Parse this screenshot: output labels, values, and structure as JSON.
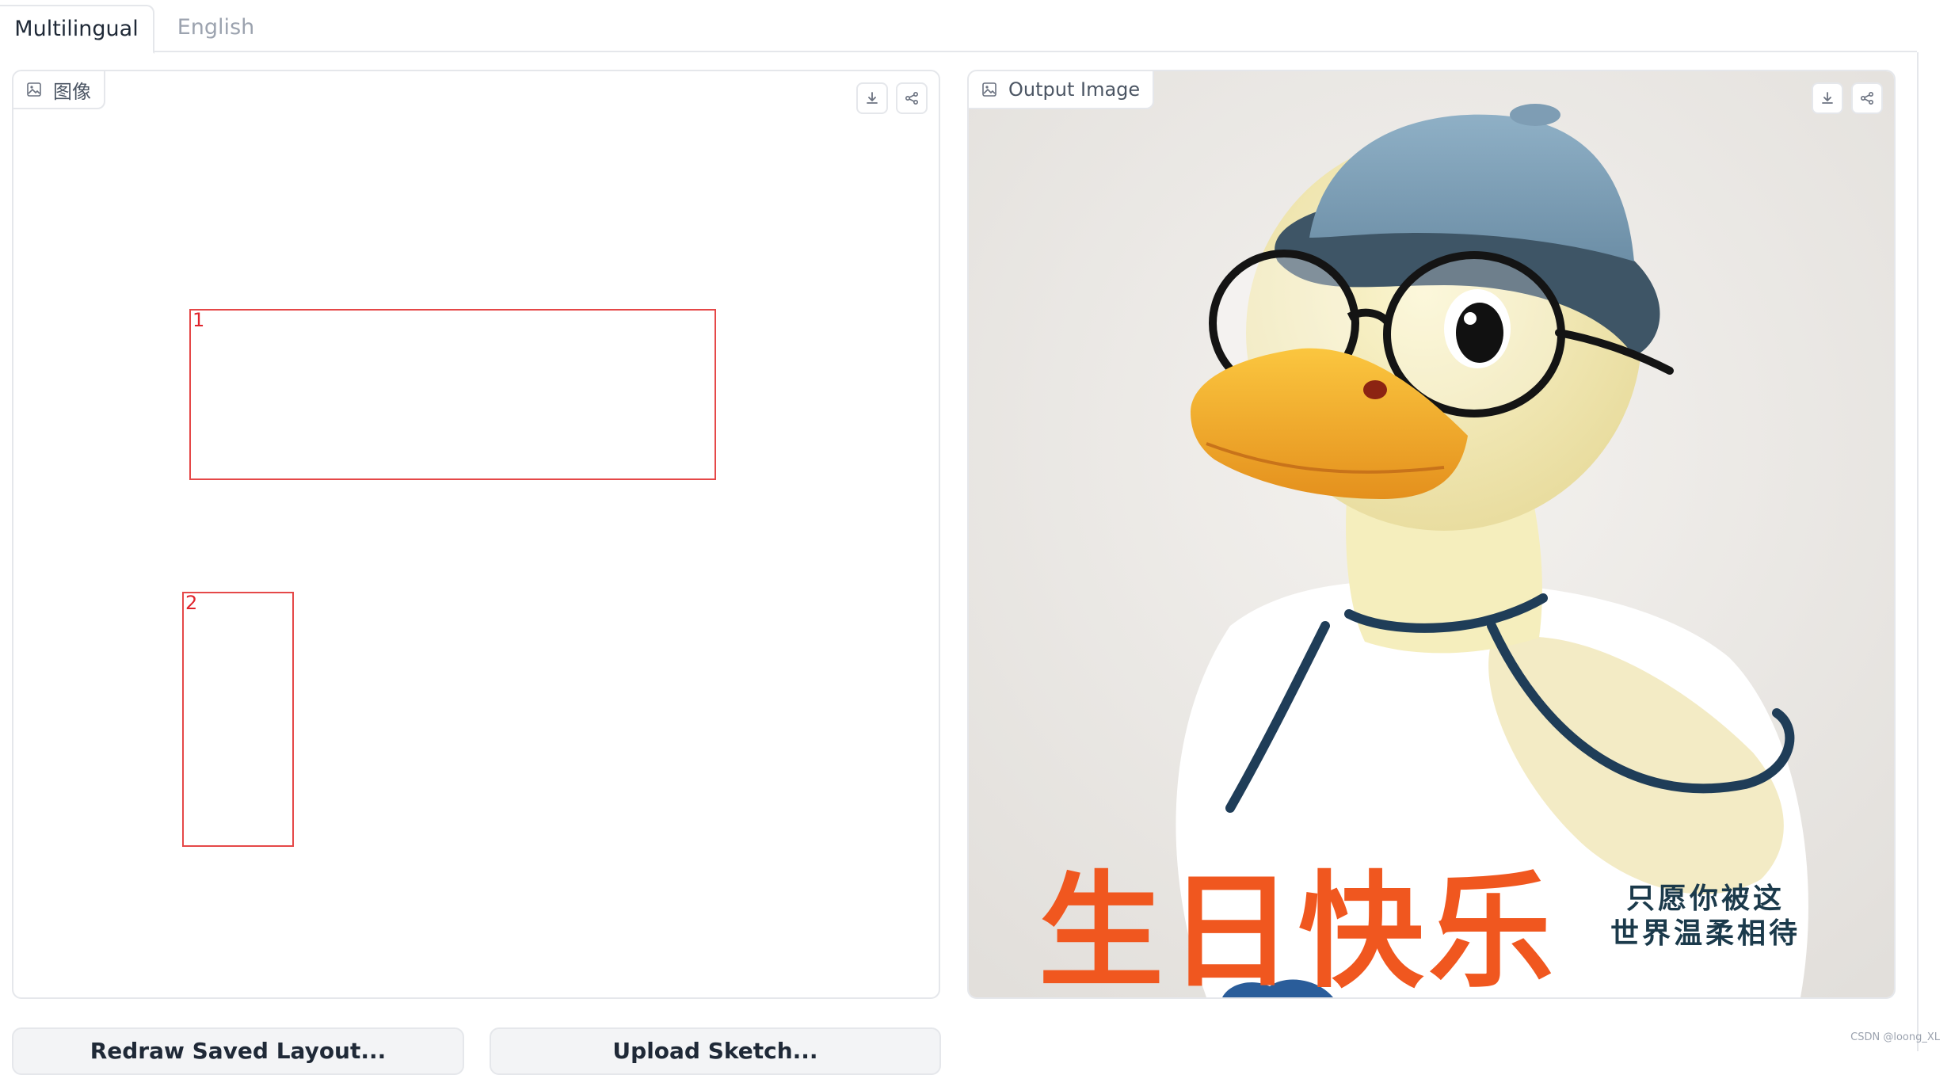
{
  "tabs": [
    {
      "label": "Multilingual",
      "active": true
    },
    {
      "label": "English",
      "active": false
    }
  ],
  "left_panel": {
    "label": "图像",
    "icon": "image-icon",
    "buttons": [
      "download-icon",
      "share-icon"
    ],
    "boxes": [
      {
        "number": "1"
      },
      {
        "number": "2"
      }
    ],
    "box_color": "#e54848"
  },
  "right_panel": {
    "label": "Output Image",
    "icon": "image-icon",
    "buttons": [
      "download-icon",
      "share-icon"
    ],
    "image_text": {
      "main": "生日快乐",
      "line1": "只愿你被这",
      "line2": "世界温柔相待"
    },
    "text_colors": {
      "main": "#f0571f",
      "small": "#1b3a4b"
    }
  },
  "bottom_buttons": {
    "a": "Redraw Saved Layout...",
    "b": "Upload Sketch..."
  },
  "watermark": "CSDN @loong_XL"
}
